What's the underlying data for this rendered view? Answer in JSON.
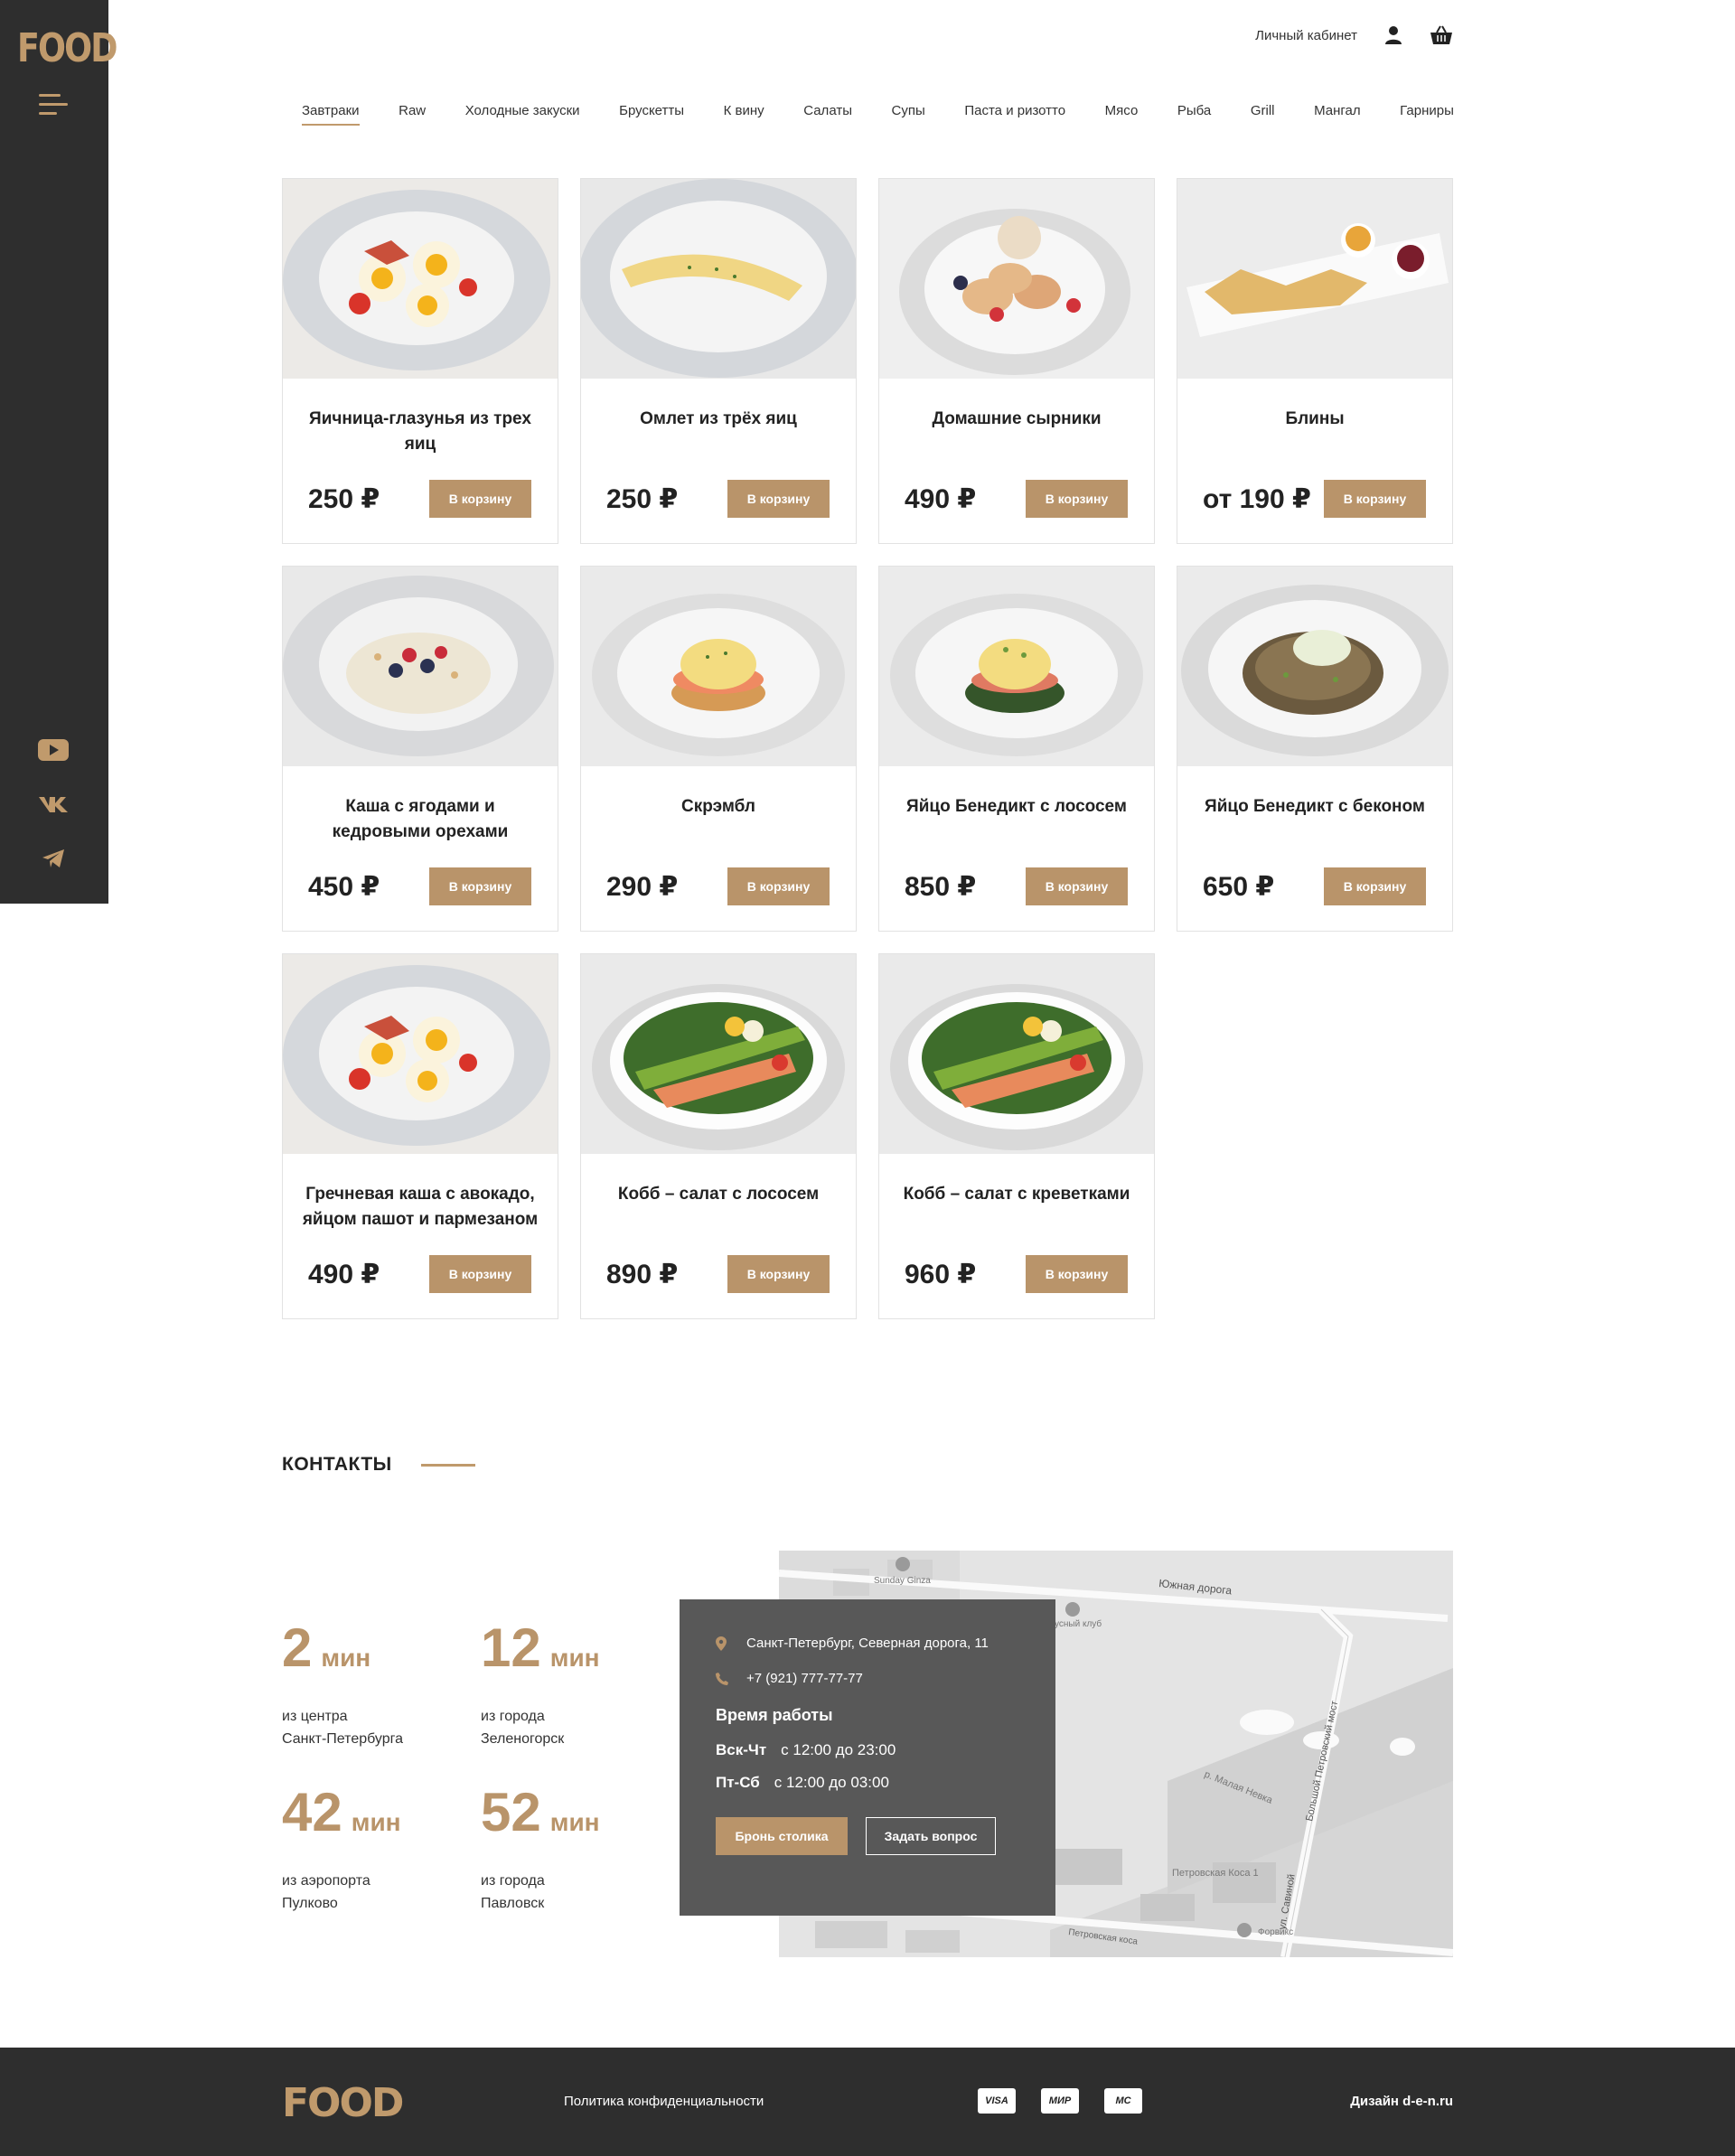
{
  "brand": {
    "logo": "FOOD",
    "accent": "#b9946a",
    "dark": "#2e2e2e"
  },
  "sidebar": {
    "social": [
      {
        "icon": "youtube-icon"
      },
      {
        "icon": "vk-icon"
      },
      {
        "icon": "telegram-icon"
      }
    ]
  },
  "header": {
    "account_label": "Личный кабинет"
  },
  "nav": [
    "Завтраки",
    "Raw",
    "Холодные закуски",
    "Брускетты",
    "К вину",
    "Салаты",
    "Супы",
    "Паста и ризотто",
    "Мясо",
    "Рыба",
    "Grill",
    "Мангал",
    "Гарниры"
  ],
  "nav_active": 0,
  "cart_button": "В корзину",
  "products": [
    {
      "title": "Яичница-глазунья из трех яиц",
      "price": "250 ₽"
    },
    {
      "title": "Омлет из трёх яиц",
      "price": "250 ₽"
    },
    {
      "title": "Домашние сырники",
      "price": "490 ₽"
    },
    {
      "title": "Блины",
      "price": "от 190 ₽"
    },
    {
      "title": "Каша с ягодами и кедровыми орехами",
      "price": "450 ₽"
    },
    {
      "title": "Скрэмбл",
      "price": "290 ₽"
    },
    {
      "title": "Яйцо Бенедикт с лососем",
      "price": "850 ₽"
    },
    {
      "title": "Яйцо Бенедикт с беконом",
      "price": "650 ₽"
    },
    {
      "title": "Гречневая каша с авокадо, яйцом пашот и пармезаном",
      "price": "490 ₽"
    },
    {
      "title": "Кобб – салат с лососем",
      "price": "890 ₽"
    },
    {
      "title": "Кобб – салат с креветками",
      "price": "960 ₽"
    }
  ],
  "contacts": {
    "title": "КОНТАКТЫ",
    "stats": [
      {
        "num": "2",
        "unit": "мин",
        "line1": "из центра",
        "line2": "Санкт-Петербурга"
      },
      {
        "num": "12",
        "unit": "мин",
        "line1": "из города",
        "line2": "Зеленогорск"
      },
      {
        "num": "42",
        "unit": "мин",
        "line1": "из аэропорта",
        "line2": "Пулково"
      },
      {
        "num": "52",
        "unit": "мин",
        "line1": "из города",
        "line2": "Павловск"
      }
    ],
    "address": "Санкт-Петербург, Северная дорога, 11",
    "phone": "+7 (921) 777-77-77",
    "hours_title": "Время работы",
    "hours": [
      {
        "days": "Вск-Чт",
        "time": "с 12:00 до 23:00"
      },
      {
        "days": "Пт-Сб",
        "time": "с 12:00 до 03:00"
      }
    ],
    "book_button": "Бронь столика",
    "ask_button": "Задать вопрос"
  },
  "map": {
    "labels": [
      "Sunday Ginza",
      "Южная дорога",
      "усный клуб",
      "р. Малая Невка",
      "Большой Петровский мост",
      "ул. Савиной",
      "Петровская Коса 1",
      "Форвикс",
      "Петровская коса"
    ]
  },
  "footer": {
    "logo": "FOOD",
    "policy": "Политика конфиденциальности",
    "payments": [
      "VISA",
      "МИР",
      "MC"
    ],
    "design": "Дизайн d-e-n.ru"
  }
}
